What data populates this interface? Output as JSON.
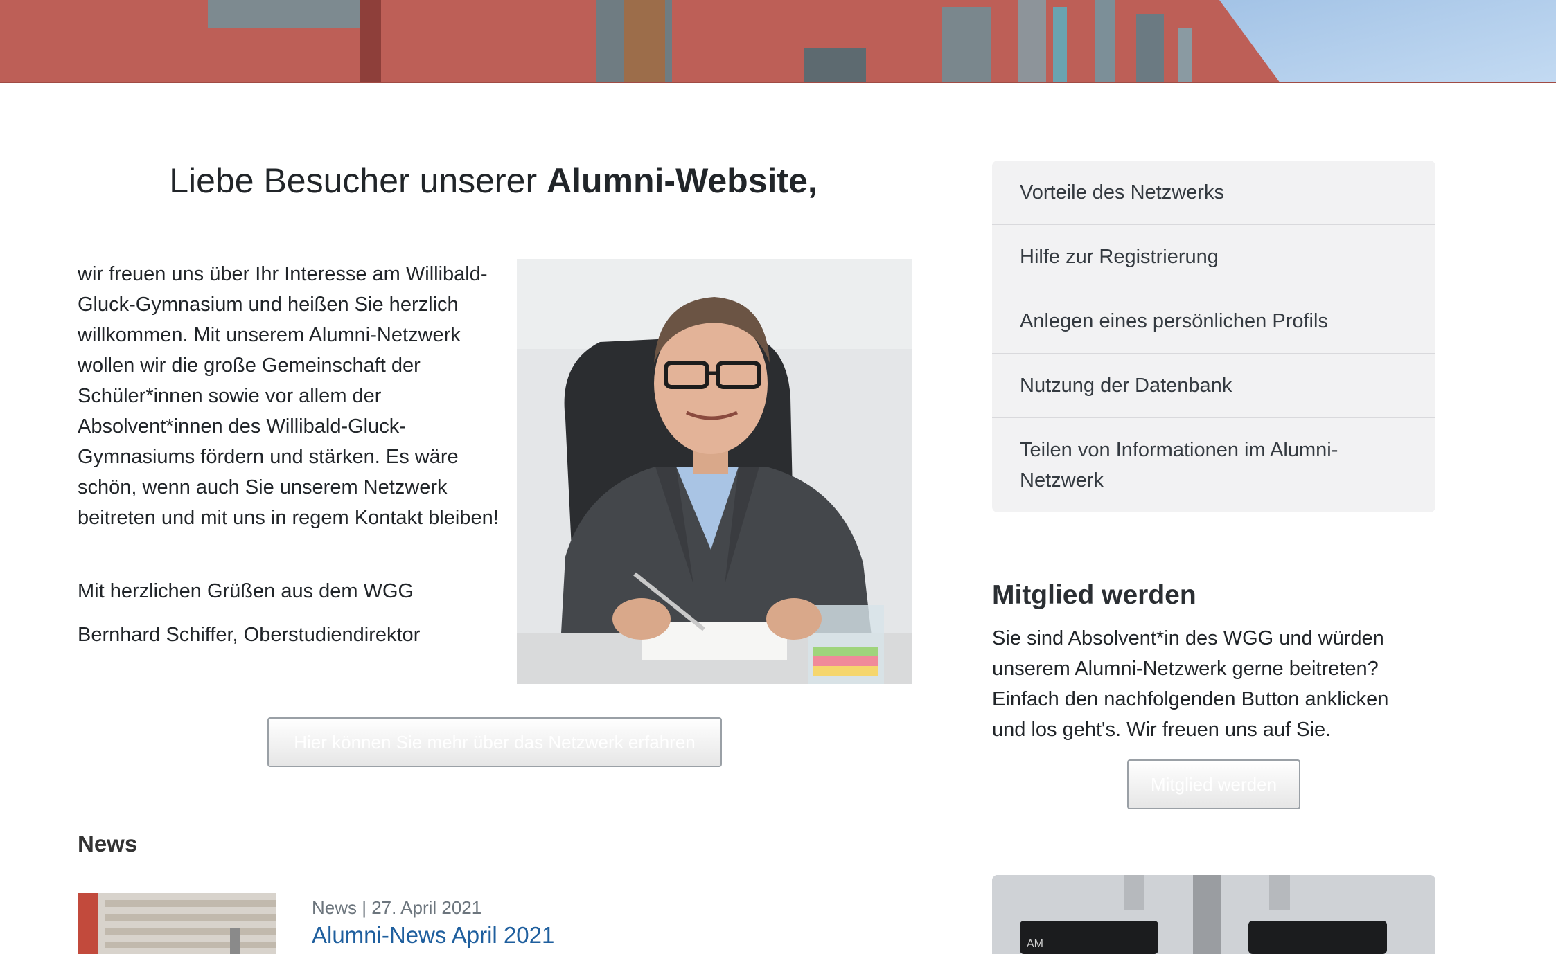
{
  "welcome": {
    "title_prefix": "Liebe Besucher unserer ",
    "title_bold": "Alumni-Website,",
    "intro": "wir freuen uns über Ihr Interesse am Willibald-Gluck-Gymnasium und heißen Sie herzlich willkommen. Mit unserem Alumni-Netzwerk wollen wir die große Gemeinschaft der Schüler*innen sowie vor allem der Absolvent*innen des Willibald-Gluck-Gymnasiums fördern und stärken. Es wäre schön, wenn auch Sie unserem Netzwerk beitreten und mit uns in regem Kontakt bleiben!",
    "greeting": "Mit herzlichen Grüßen aus dem WGG",
    "signature": "Bernhard Schiffer, Oberstudiendirektor",
    "network_button": "Hier können Sie mehr über das Netzwerk erfahren"
  },
  "sidebar": {
    "items": [
      {
        "label": "Vorteile des Netzwerks"
      },
      {
        "label": "Hilfe zur Registrierung"
      },
      {
        "label": "Anlegen eines persönlichen Profils"
      },
      {
        "label": "Nutzung der Datenbank"
      },
      {
        "label": "Teilen von Informationen im Alumni-Netzwerk"
      }
    ]
  },
  "membership": {
    "heading": "Mitglied werden",
    "text": "Sie sind Absolvent*in des WGG und würden unserem Alumni-Netzwerk gerne beitreten? Einfach den nachfolgenden Button anklicken und los geht's. Wir freuen uns auf Sie.",
    "button": "Mitglied werden"
  },
  "news": {
    "heading": "News",
    "items": [
      {
        "meta": "News | 27. April 2021",
        "title": "Alumni-News April 2021"
      }
    ]
  },
  "colors": {
    "link": "#1f5f9e",
    "sidebar_bg": "#f2f2f3",
    "text": "#212529"
  }
}
